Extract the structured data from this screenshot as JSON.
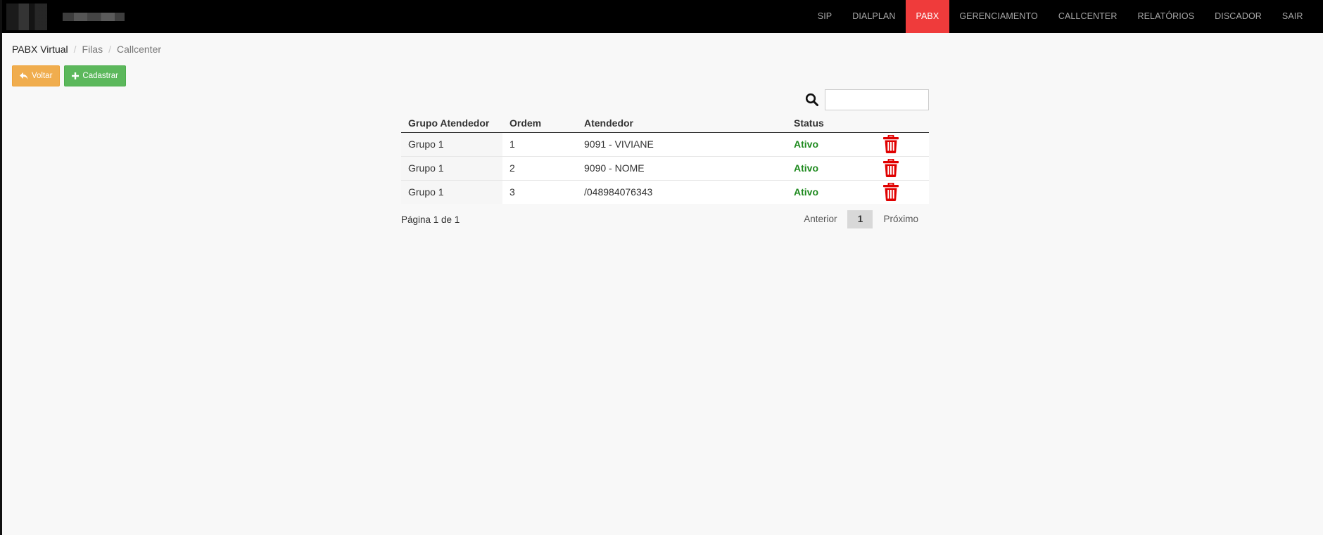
{
  "navbar": {
    "items": [
      {
        "label": "SIP"
      },
      {
        "label": "DIALPLAN"
      },
      {
        "label": "PABX"
      },
      {
        "label": "GERENCIAMENTO"
      },
      {
        "label": "CALLCENTER"
      },
      {
        "label": "RELATÓRIOS"
      },
      {
        "label": "DISCADOR"
      },
      {
        "label": "SAIR"
      }
    ],
    "active_item": "PABX",
    "active_color": "#ef3b3b"
  },
  "breadcrumb": {
    "items": [
      "PABX Virtual",
      "Filas",
      "Callcenter"
    ],
    "separator": "/"
  },
  "actions": {
    "back_label": "Voltar",
    "back_icon": "reply-icon",
    "create_label": "Cadastrar",
    "create_icon": "plus-icon"
  },
  "search": {
    "icon": "search-icon",
    "value": ""
  },
  "table": {
    "headers": [
      "Grupo Atendedor",
      "Ordem",
      "Atendedor",
      "Status"
    ],
    "rows": [
      {
        "group": "Grupo 1",
        "order": "1",
        "agent": "9091 - VIVIANE",
        "status": "Ativo"
      },
      {
        "group": "Grupo 1",
        "order": "2",
        "agent": "9090 - NOME",
        "status": "Ativo"
      },
      {
        "group": "Grupo 1",
        "order": "3",
        "agent": "/048984076343",
        "status": "Ativo"
      }
    ],
    "row_action_icon": "trash-icon",
    "status_color": "#1e8a1e",
    "delete_color": "#e00000"
  },
  "pagination": {
    "info": "Página 1 de 1",
    "prev_label": "Anterior",
    "current_page": "1",
    "next_label": "Próximo"
  }
}
